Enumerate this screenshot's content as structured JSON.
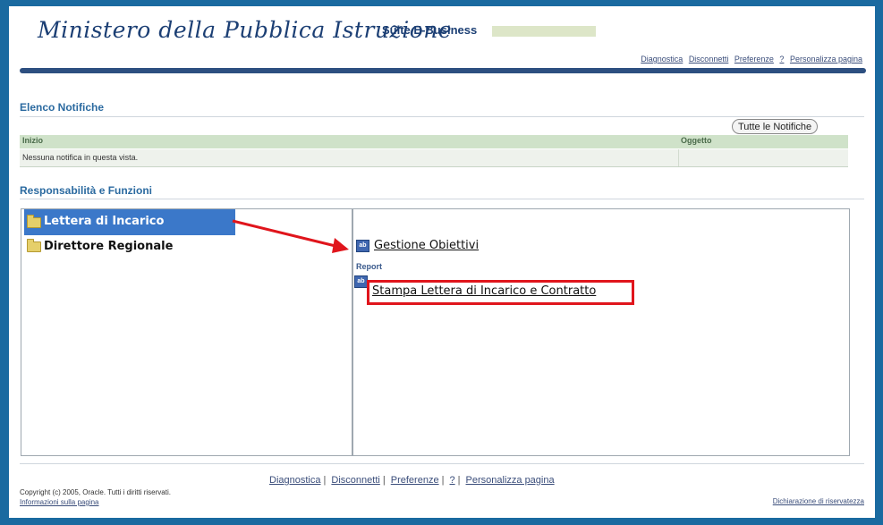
{
  "header": {
    "logo_text": "Ministero della Pubblica Istruzione",
    "suite_title": "Suite E-Business",
    "links": [
      "Diagnostica",
      "Disconnetti",
      "Preferenze",
      "?",
      "Personalizza pagina"
    ]
  },
  "notifications": {
    "title": "Elenco Notifiche",
    "button_all": "Tutte le Notifiche",
    "columns": [
      "Inizio",
      "Oggetto"
    ],
    "empty_text": "Nessuna notifica in questa vista."
  },
  "responsibilities": {
    "title": "Responsabilità e Funzioni",
    "items": [
      {
        "label": "Lettera di Incarico",
        "selected": true
      },
      {
        "label": "Direttore Regionale",
        "selected": false
      }
    ],
    "functions": {
      "main_link": "Gestione Obiettivi",
      "report_heading": "Report",
      "report_link": "Stampa Lettera di Incarico  e Contratto"
    }
  },
  "footer": {
    "links": [
      "Diagnostica",
      "Disconnetti",
      "Preferenze",
      "?",
      "Personalizza pagina"
    ],
    "copyright": "Copyright (c) 2005, Oracle. Tutti i diritti riservati.",
    "info_link": "Informazioni sulla pagina",
    "privacy_link": "Dichiarazione di riservatezza"
  },
  "colors": {
    "frame": "#1a6aa0",
    "selection": "#3b78c9",
    "highlight_box": "#e0151c",
    "arrow": "#e0151c"
  },
  "icons": {
    "folder": "folder-icon",
    "function": "function-icon"
  }
}
